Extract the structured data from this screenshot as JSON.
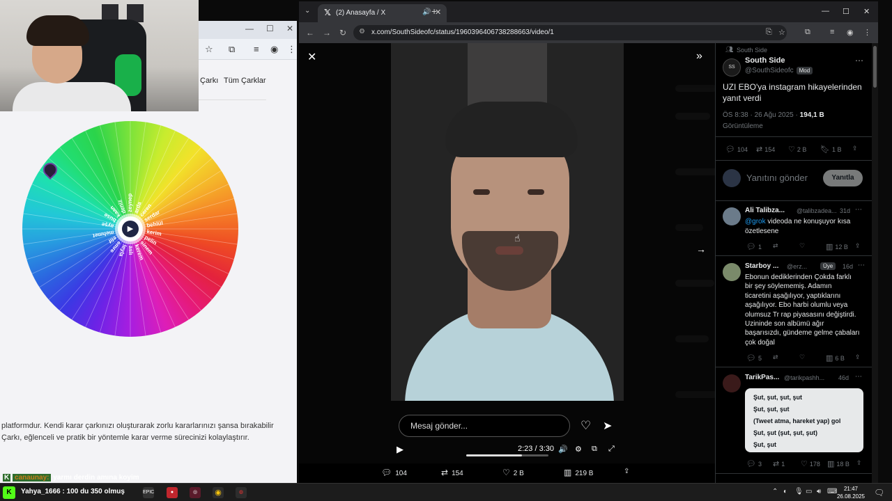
{
  "left_browser": {
    "nav_items": [
      "Çarkı",
      "Tüm Çarklar"
    ],
    "wheel_labels": [
      "serdar",
      "behlül",
      "kerim",
      "pelin",
      "sinem",
      "kerem",
      "aslı",
      "leyla",
      "emre",
      "elif",
      "mehmet",
      "ayşe",
      "buse",
      "kaan",
      "deniz",
      "zeynep",
      "arda",
      "ceren"
    ],
    "description_lines": [
      "platformdur. Kendi karar çarkınızı oluşturarak zorlu kararlarınızı şansa bırakabilir",
      "Çarkı, eğlenceli ve pratik bir yöntemle karar verme sürecinizi kolaylaştırır."
    ]
  },
  "browser": {
    "tab_title": "(2) Anasayfa / X",
    "url": "x.com/SouthSideofc/status/1960396406738288663/video/1"
  },
  "video": {
    "message_placeholder": "Mesaj gönder...",
    "time": "2:23 / 3:30",
    "progress": 0.68,
    "stats": {
      "replies": "104",
      "reposts": "154",
      "likes": "2 B",
      "views": "219 B"
    }
  },
  "sidebar": {
    "context": "South Side",
    "author_name": "South Side",
    "author_handle": "@SouthSideofc",
    "author_badge": "Mod",
    "post_text": "UZI EBO'ya instagram hikayelerinden yanıt verdi",
    "post_meta": "ÖS 8:38 · 26 Ağu 2025 · ",
    "post_views": "194,1 B",
    "post_views_label": "Görüntüleme",
    "actions": {
      "replies": "104",
      "reposts": "154",
      "likes": "2 B",
      "bookmarks": "1 B"
    },
    "reply_placeholder": "Yanıtını gönder",
    "reply_button": "Yanıtla",
    "replies": [
      {
        "name": "Ali Talibza...",
        "handle": "@talibzadea...",
        "age": "31d",
        "mention": "@grok",
        "text": "videoda ne konuşuyor kısa özetlesene",
        "stats": {
          "replies": "1",
          "reposts": "",
          "likes": "",
          "views": "12 B"
        }
      },
      {
        "name": "Starboy ...",
        "handle": "@erz...",
        "badge": "Üye",
        "age": "16d",
        "lines": [
          "Ebonun dediklerinden Çokda farklı",
          "bir şey söylememiş. Adamın",
          "ticaretini aşağılıyor, yaptıklarını",
          "aşağılıyor. Ebo harbi olumlu veya",
          "olumsuz Tr rap piyasasını değiştirdi.",
          "Uzininde son albümü ağır",
          "başarısızdı, gündeme gelme çabaları",
          "çok doğal"
        ],
        "stats": {
          "replies": "5",
          "reposts": "",
          "likes": "",
          "views": "6 B"
        }
      },
      {
        "name": "TarikPas...",
        "handle": "@tarikpashh...",
        "age": "46d",
        "quote_lines": [
          "Şut, şut, şut, şut",
          "Şut, şut, şut",
          "(Tweet atma, hareket yap) gol",
          "Şut, şut (şut, şut, şut)",
          "Şut, şut"
        ],
        "stats": {
          "replies": "3",
          "reposts": "1",
          "likes": "178",
          "views": "18 B"
        }
      }
    ]
  },
  "overlay": {
    "chat_user": "canaunay:",
    "chat_message": "yarmı derdin amına koyim"
  },
  "taskbar": {
    "task_text": "Yahya_1666 : 100 du 350 olmuş",
    "clock_time": "21:47",
    "clock_date": "26.08.2025"
  },
  "colors": {
    "x_bg": "#000000",
    "x_text": "#e7e9ea",
    "x_muted": "#71767b",
    "link": "#1d9bf0"
  }
}
